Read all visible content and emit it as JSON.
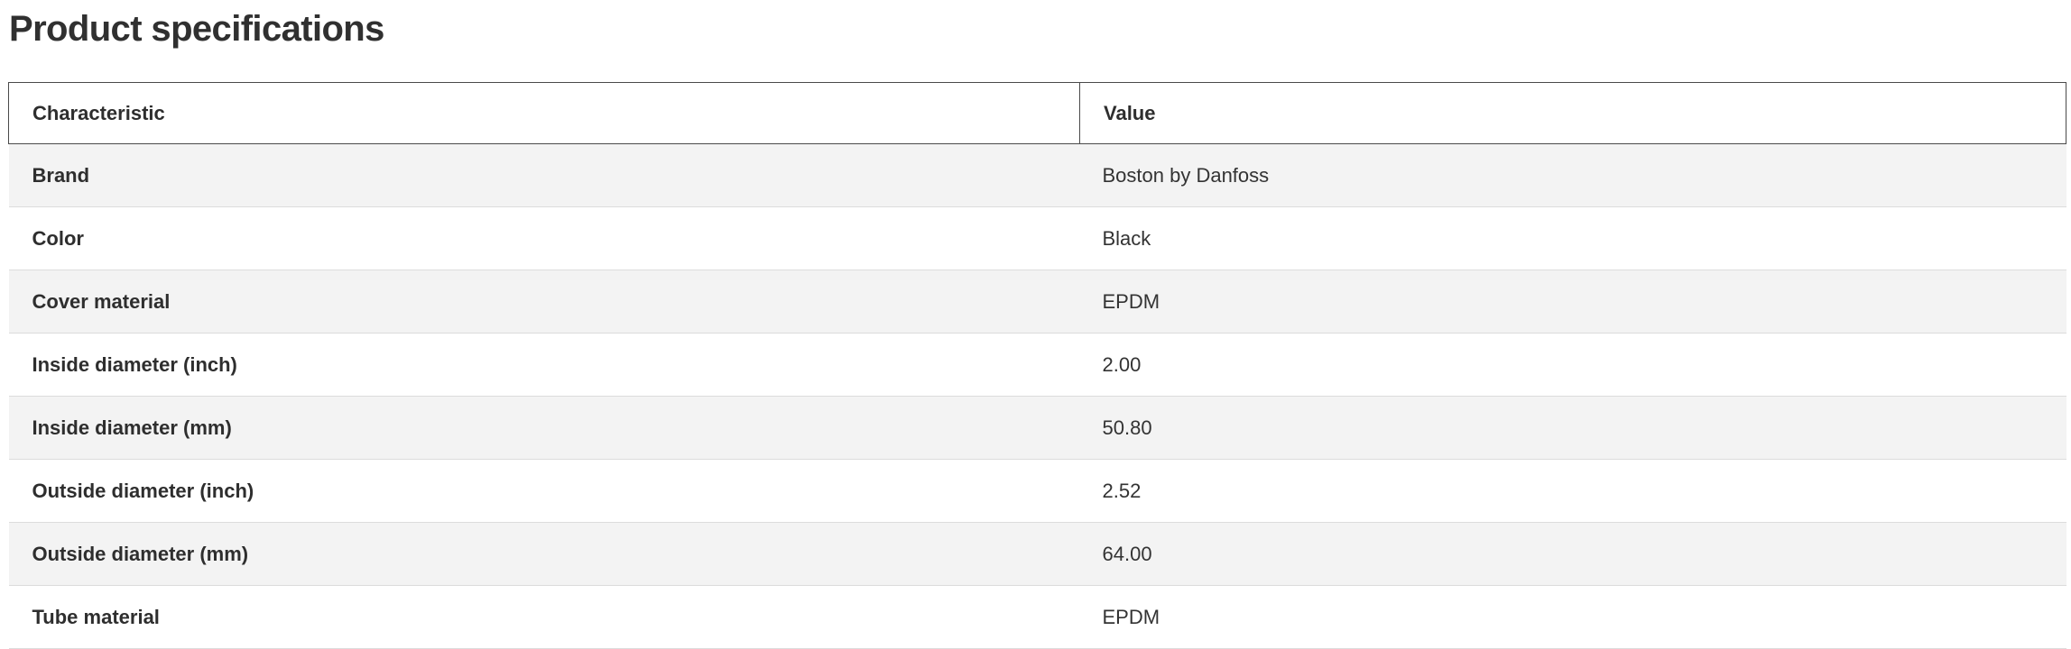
{
  "page_title": "Product specifications",
  "table": {
    "headers": [
      "Characteristic",
      "Value"
    ],
    "rows": [
      {
        "characteristic": "Brand",
        "value": "Boston by Danfoss"
      },
      {
        "characteristic": "Color",
        "value": "Black"
      },
      {
        "characteristic": "Cover material",
        "value": "EPDM"
      },
      {
        "characteristic": "Inside diameter (inch)",
        "value": "2.00"
      },
      {
        "characteristic": "Inside diameter (mm)",
        "value": "50.80"
      },
      {
        "characteristic": "Outside diameter (inch)",
        "value": "2.52"
      },
      {
        "characteristic": "Outside diameter (mm)",
        "value": "64.00"
      },
      {
        "characteristic": "Tube material",
        "value": "EPDM"
      }
    ]
  },
  "colors": {
    "text": "#333333",
    "stripe": "#f3f3f3",
    "header_border": "#4a4a4a",
    "row_divider": "#dcdcdc"
  }
}
